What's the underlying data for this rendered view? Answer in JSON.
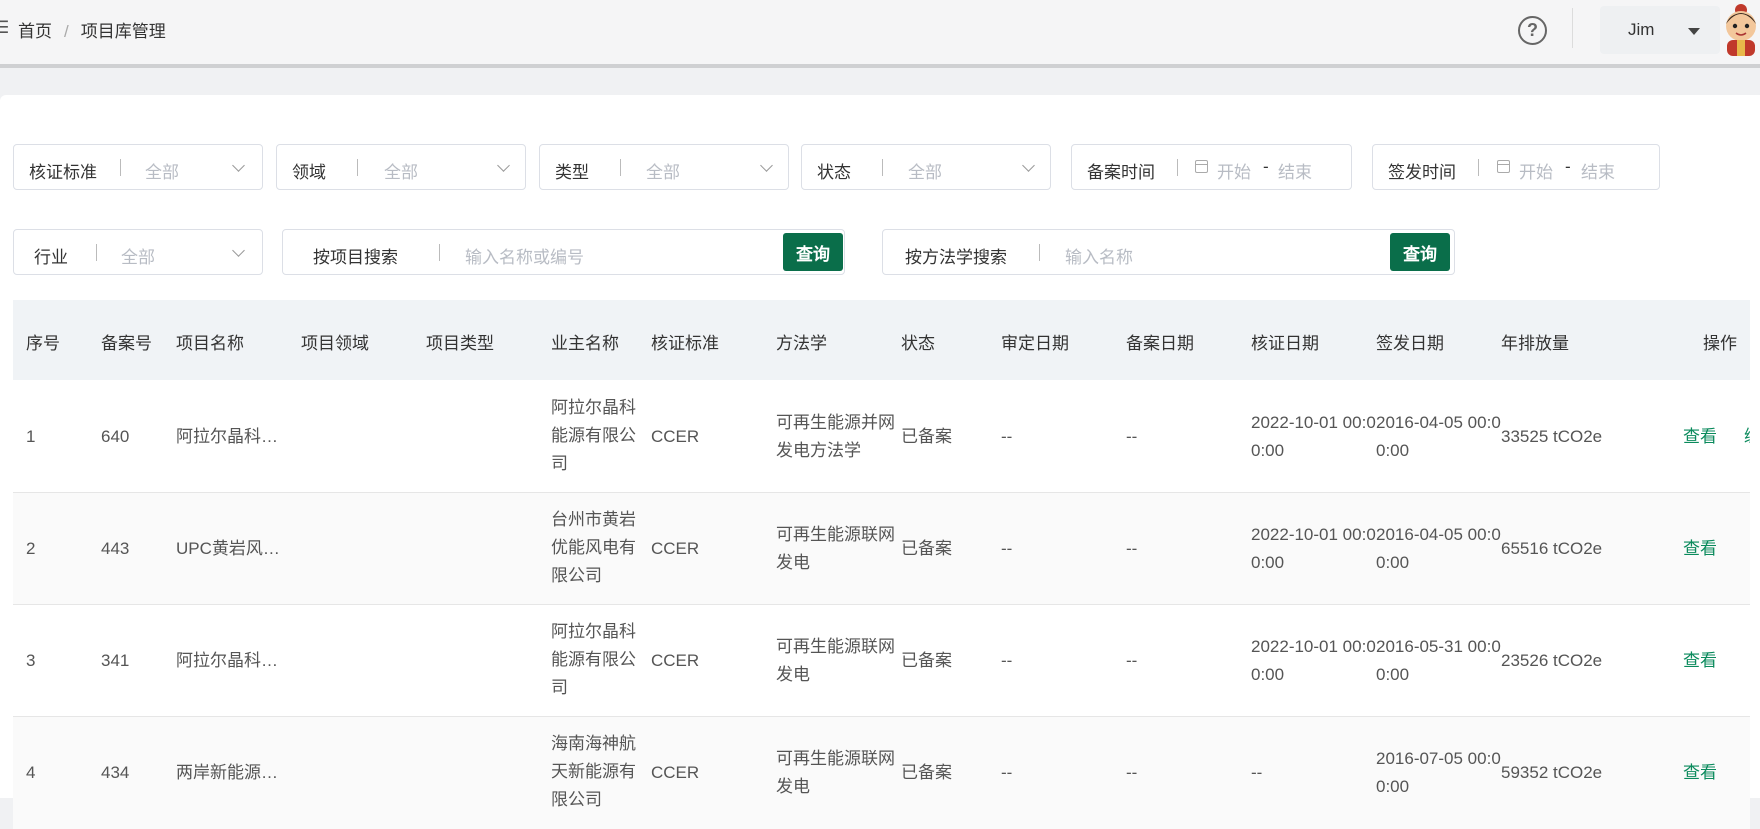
{
  "header": {
    "breadcrumb": [
      "首页",
      "项目库管理"
    ],
    "breadcrumb_sep": "/",
    "user_name": "Jim"
  },
  "filters": {
    "standard": {
      "label": "核证标准",
      "value": "全部"
    },
    "domain": {
      "label": "领域",
      "value": "全部"
    },
    "type": {
      "label": "类型",
      "value": "全部"
    },
    "status": {
      "label": "状态",
      "value": "全部"
    },
    "filing_time": {
      "label": "备案时间",
      "start": "开始",
      "end": "结束"
    },
    "issue_time": {
      "label": "签发时间",
      "start": "开始",
      "end": "结束"
    },
    "industry": {
      "label": "行业",
      "value": "全部"
    },
    "project_search": {
      "label": "按项目搜索",
      "placeholder": "输入名称或编号",
      "button": "查询"
    },
    "method_search": {
      "label": "按方法学搜索",
      "placeholder": "输入名称",
      "button": "查询"
    },
    "range_sep": "-"
  },
  "table": {
    "columns": [
      "序号",
      "备案号",
      "项目名称",
      "项目领域",
      "项目类型",
      "业主名称",
      "核证标准",
      "方法学",
      "状态",
      "审定日期",
      "备案日期",
      "核证日期",
      "签发日期",
      "年排放量",
      "操作"
    ],
    "rows": [
      {
        "no": "1",
        "filing_no": "640",
        "name": "阿拉尔晶科二…",
        "domain": "",
        "type": "",
        "owner": "阿拉尔晶科能源有限公司",
        "standard": "CCER",
        "method": "可再生能源并网发电方法学",
        "status": "已备案",
        "validation_date": "--",
        "filing_date": "--",
        "verification_date": "2022-10-01 00:00:00",
        "issue_date": "2016-04-05 00:00:00",
        "emission": "33525 tCO2e",
        "action": "查看"
      },
      {
        "no": "2",
        "filing_no": "443",
        "name": "UPC黄岩风…",
        "domain": "",
        "type": "",
        "owner": "台州市黄岩优能风电有限公司",
        "standard": "CCER",
        "method": "可再生能源联网发电",
        "status": "已备案",
        "validation_date": "--",
        "filing_date": "--",
        "verification_date": "2022-10-01 00:00:00",
        "issue_date": "2016-04-05 00:00:00",
        "emission": "65516 tCO2e",
        "action": "查看"
      },
      {
        "no": "3",
        "filing_no": "341",
        "name": "阿拉尔晶科能…",
        "domain": "",
        "type": "",
        "owner": "阿拉尔晶科能源有限公司",
        "standard": "CCER",
        "method": "可再生能源联网发电",
        "status": "已备案",
        "validation_date": "--",
        "filing_date": "--",
        "verification_date": "2022-10-01 00:00:00",
        "issue_date": "2016-05-31 00:00:00",
        "emission": "23526 tCO2e",
        "action": "查看"
      },
      {
        "no": "4",
        "filing_no": "434",
        "name": "两岸新能源合…",
        "domain": "",
        "type": "",
        "owner": "海南海神航天新能源有限公司",
        "standard": "CCER",
        "method": "可再生能源联网发电",
        "status": "已备案",
        "validation_date": "--",
        "filing_date": "--",
        "verification_date": "--",
        "issue_date": "2016-07-05 00:00:00",
        "emission": "59352 tCO2e",
        "action": "查看"
      }
    ]
  },
  "colors": {
    "accent": "#0a6e4a",
    "link": "#0a8a5c"
  }
}
